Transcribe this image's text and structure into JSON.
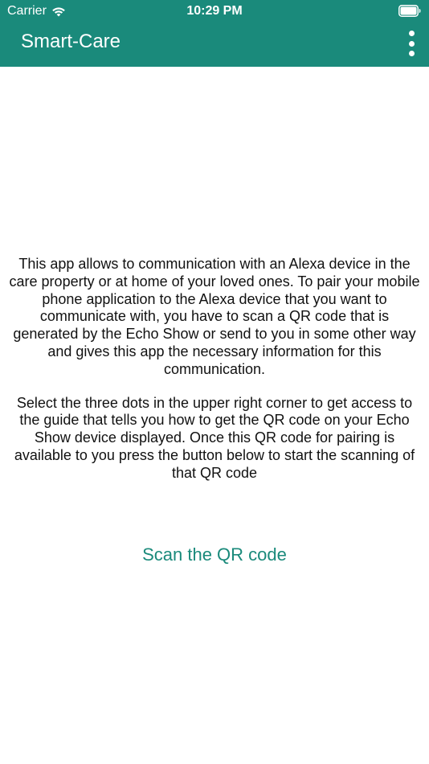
{
  "status_bar": {
    "carrier": "Carrier",
    "time": "10:29 PM"
  },
  "app_bar": {
    "title": "Smart-Care",
    "menu_icon": "more-vertical-icon"
  },
  "content": {
    "paragraph_1": "This app allows to communication with an Alexa device in the care property or at home of your loved ones. To pair your mobile phone application to the Alexa device that you want to communicate with, you have to scan a QR code that is generated by the Echo Show or send to you in some other way and gives this app the necessary information for this communication.",
    "paragraph_2": "Select the three dots in the upper right corner to get access to the guide that tells you how to get the QR code on your Echo Show device displayed. Once this QR code for pairing is available to you press the button below to start the scanning of that QR code"
  },
  "actions": {
    "scan_label": "Scan the QR code"
  },
  "colors": {
    "brand": "#1a8a7b",
    "text": "#111111",
    "background": "#ffffff"
  }
}
